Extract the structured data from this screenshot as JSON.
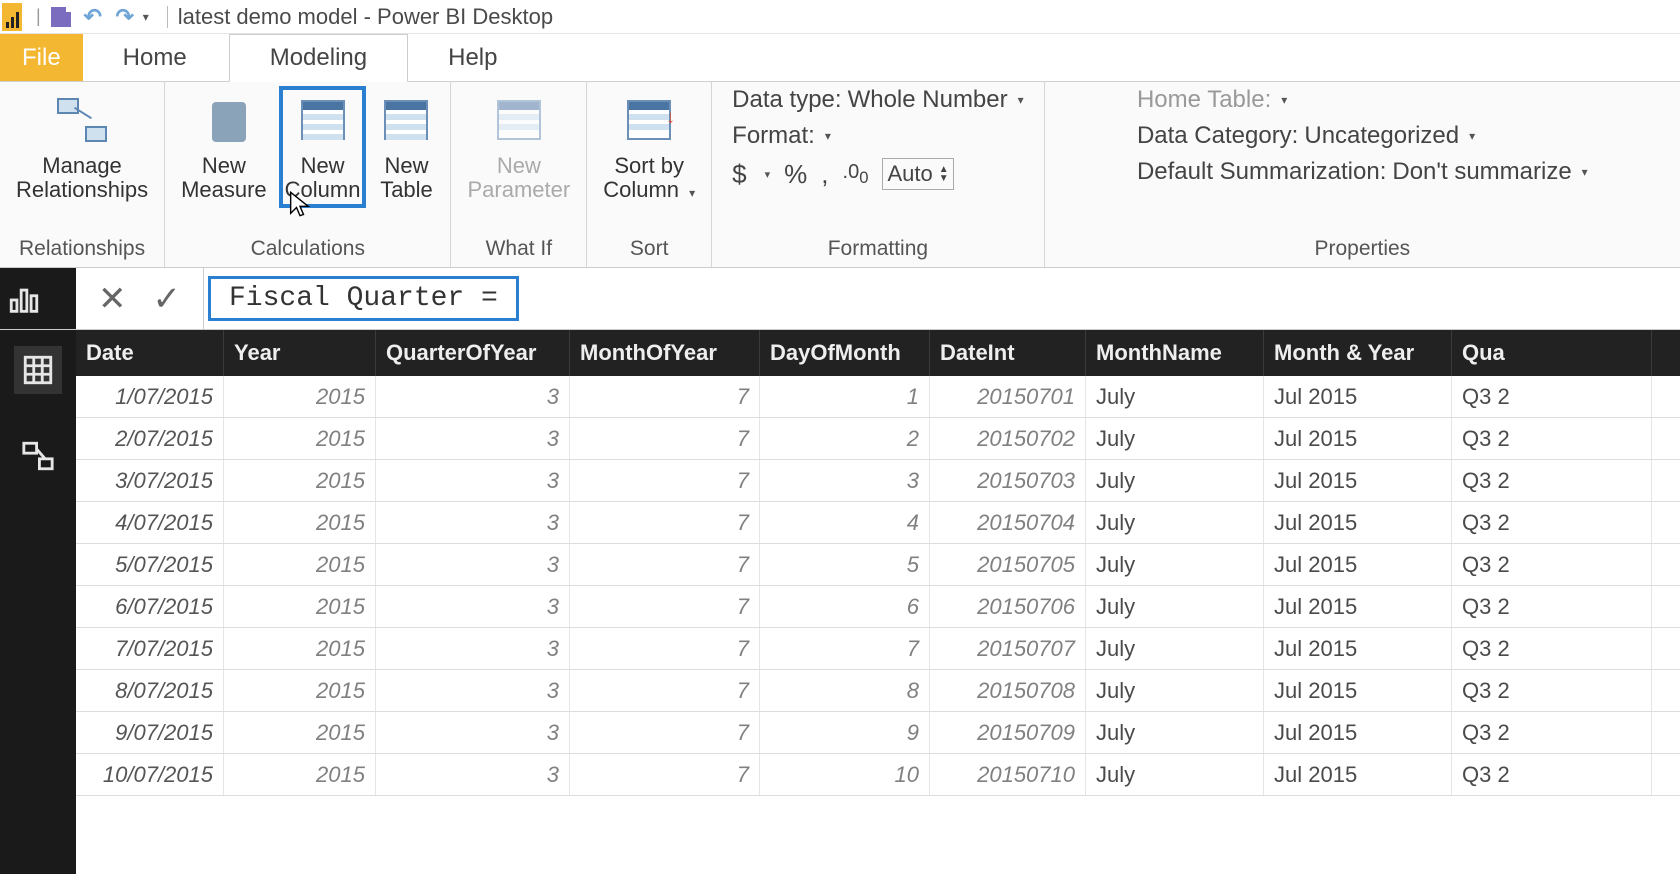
{
  "titlebar": {
    "title": "latest demo model - Power BI Desktop"
  },
  "tabs": {
    "file": "File",
    "items": [
      "Home",
      "Modeling",
      "Help"
    ],
    "active_index": 1
  },
  "ribbon": {
    "groups": {
      "relationships": {
        "label": "Relationships",
        "manage": "Manage\nRelationships"
      },
      "calculations": {
        "label": "Calculations",
        "measure": "New\nMeasure",
        "column": "New\nColumn",
        "table": "New\nTable"
      },
      "whatif": {
        "label": "What If",
        "parameter": "New\nParameter"
      },
      "sort": {
        "label": "Sort",
        "sortby": "Sort by\nColumn "
      },
      "formatting": {
        "label": "Formatting",
        "data_type_label": "Data type: ",
        "data_type_value": "Whole Number",
        "format_label": "Format: ",
        "currency": "$",
        "percent": "%",
        "thousands": ",",
        "decimals": ".0₀",
        "auto": "Auto"
      },
      "properties": {
        "label": "Properties",
        "home_table_label": "Home Table: ",
        "data_category_label": "Data Category: ",
        "data_category_value": "Uncategorized",
        "summarization_label": "Default Summarization: ",
        "summarization_value": "Don't summarize"
      }
    }
  },
  "formula": {
    "text": "Fiscal Quarter ="
  },
  "grid": {
    "columns": [
      "Date",
      "Year",
      "QuarterOfYear",
      "MonthOfYear",
      "DayOfMonth",
      "DateInt",
      "MonthName",
      "Month & Year",
      "Qua"
    ],
    "rows": [
      {
        "Date": "1/07/2015",
        "Year": "2015",
        "QuarterOfYear": "3",
        "MonthOfYear": "7",
        "DayOfMonth": "1",
        "DateInt": "20150701",
        "MonthName": "July",
        "MonthYear": "Jul 2015",
        "Qua": "Q3 2"
      },
      {
        "Date": "2/07/2015",
        "Year": "2015",
        "QuarterOfYear": "3",
        "MonthOfYear": "7",
        "DayOfMonth": "2",
        "DateInt": "20150702",
        "MonthName": "July",
        "MonthYear": "Jul 2015",
        "Qua": "Q3 2"
      },
      {
        "Date": "3/07/2015",
        "Year": "2015",
        "QuarterOfYear": "3",
        "MonthOfYear": "7",
        "DayOfMonth": "3",
        "DateInt": "20150703",
        "MonthName": "July",
        "MonthYear": "Jul 2015",
        "Qua": "Q3 2"
      },
      {
        "Date": "4/07/2015",
        "Year": "2015",
        "QuarterOfYear": "3",
        "MonthOfYear": "7",
        "DayOfMonth": "4",
        "DateInt": "20150704",
        "MonthName": "July",
        "MonthYear": "Jul 2015",
        "Qua": "Q3 2"
      },
      {
        "Date": "5/07/2015",
        "Year": "2015",
        "QuarterOfYear": "3",
        "MonthOfYear": "7",
        "DayOfMonth": "5",
        "DateInt": "20150705",
        "MonthName": "July",
        "MonthYear": "Jul 2015",
        "Qua": "Q3 2"
      },
      {
        "Date": "6/07/2015",
        "Year": "2015",
        "QuarterOfYear": "3",
        "MonthOfYear": "7",
        "DayOfMonth": "6",
        "DateInt": "20150706",
        "MonthName": "July",
        "MonthYear": "Jul 2015",
        "Qua": "Q3 2"
      },
      {
        "Date": "7/07/2015",
        "Year": "2015",
        "QuarterOfYear": "3",
        "MonthOfYear": "7",
        "DayOfMonth": "7",
        "DateInt": "20150707",
        "MonthName": "July",
        "MonthYear": "Jul 2015",
        "Qua": "Q3 2"
      },
      {
        "Date": "8/07/2015",
        "Year": "2015",
        "QuarterOfYear": "3",
        "MonthOfYear": "7",
        "DayOfMonth": "8",
        "DateInt": "20150708",
        "MonthName": "July",
        "MonthYear": "Jul 2015",
        "Qua": "Q3 2"
      },
      {
        "Date": "9/07/2015",
        "Year": "2015",
        "QuarterOfYear": "3",
        "MonthOfYear": "7",
        "DayOfMonth": "9",
        "DateInt": "20150709",
        "MonthName": "July",
        "MonthYear": "Jul 2015",
        "Qua": "Q3 2"
      },
      {
        "Date": "10/07/2015",
        "Year": "2015",
        "QuarterOfYear": "3",
        "MonthOfYear": "7",
        "DayOfMonth": "10",
        "DateInt": "20150710",
        "MonthName": "July",
        "MonthYear": "Jul 2015",
        "Qua": "Q3 2"
      }
    ]
  }
}
